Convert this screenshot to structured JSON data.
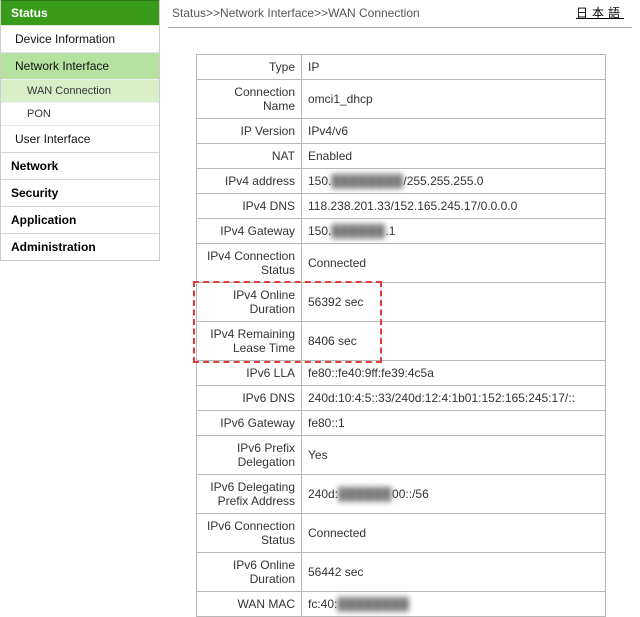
{
  "lang_link": "日本語",
  "breadcrumb": "Status>>Network Interface>>WAN Connection",
  "sidebar": {
    "status_header": "Status",
    "device_info": "Device Information",
    "network_if": "Network Interface",
    "wan_conn": "WAN Connection",
    "pon": "PON",
    "user_if": "User Interface",
    "network": "Network",
    "security": "Security",
    "application": "Application",
    "administration": "Administration"
  },
  "rows": {
    "type": {
      "label": "Type",
      "value": "IP"
    },
    "conn_name": {
      "label": "Connection Name",
      "value": "omci1_dhcp"
    },
    "ip_version": {
      "label": "IP Version",
      "value": "IPv4/v6"
    },
    "nat": {
      "label": "NAT",
      "value": "Enabled"
    },
    "ipv4_addr": {
      "label": "IPv4 address",
      "prefix": "150.",
      "mask": "████████",
      "suffix": "/255.255.255.0"
    },
    "ipv4_dns": {
      "label": "IPv4 DNS",
      "value": "118.238.201.33/152.165.245.17/0.0.0.0"
    },
    "ipv4_gw": {
      "label": "IPv4 Gateway",
      "prefix": "150.",
      "mask": "██████",
      "suffix": ".1"
    },
    "ipv4_conn_status": {
      "label": "IPv4 Connection Status",
      "value": "Connected"
    },
    "ipv4_online": {
      "label": "IPv4 Online Duration",
      "value": "56392 sec"
    },
    "ipv4_lease": {
      "label": "IPv4 Remaining Lease Time",
      "value": "8406 sec"
    },
    "ipv6_lla": {
      "label": "IPv6 LLA",
      "value": "fe80::fe40:9ff:fe39:4c5a"
    },
    "ipv6_dns": {
      "label": "IPv6 DNS",
      "value": "240d:10:4:5::33/240d:12:4:1b01:152:165:245:17/::"
    },
    "ipv6_gw": {
      "label": "IPv6 Gateway",
      "value": "fe80::1"
    },
    "ipv6_pd": {
      "label": "IPv6 Prefix Delegation",
      "value": "Yes"
    },
    "ipv6_deleg_addr": {
      "label": "IPv6 Delegating Prefix Address",
      "prefix": "240d:",
      "mask": "██████",
      "suffix": "00::/56"
    },
    "ipv6_conn_status": {
      "label": "IPv6 Connection Status",
      "value": "Connected"
    },
    "ipv6_online": {
      "label": "IPv6 Online Duration",
      "value": "56442 sec"
    },
    "wan_mac": {
      "label": "WAN MAC",
      "prefix": "fc:40:",
      "mask": "████████",
      "suffix": ""
    }
  }
}
